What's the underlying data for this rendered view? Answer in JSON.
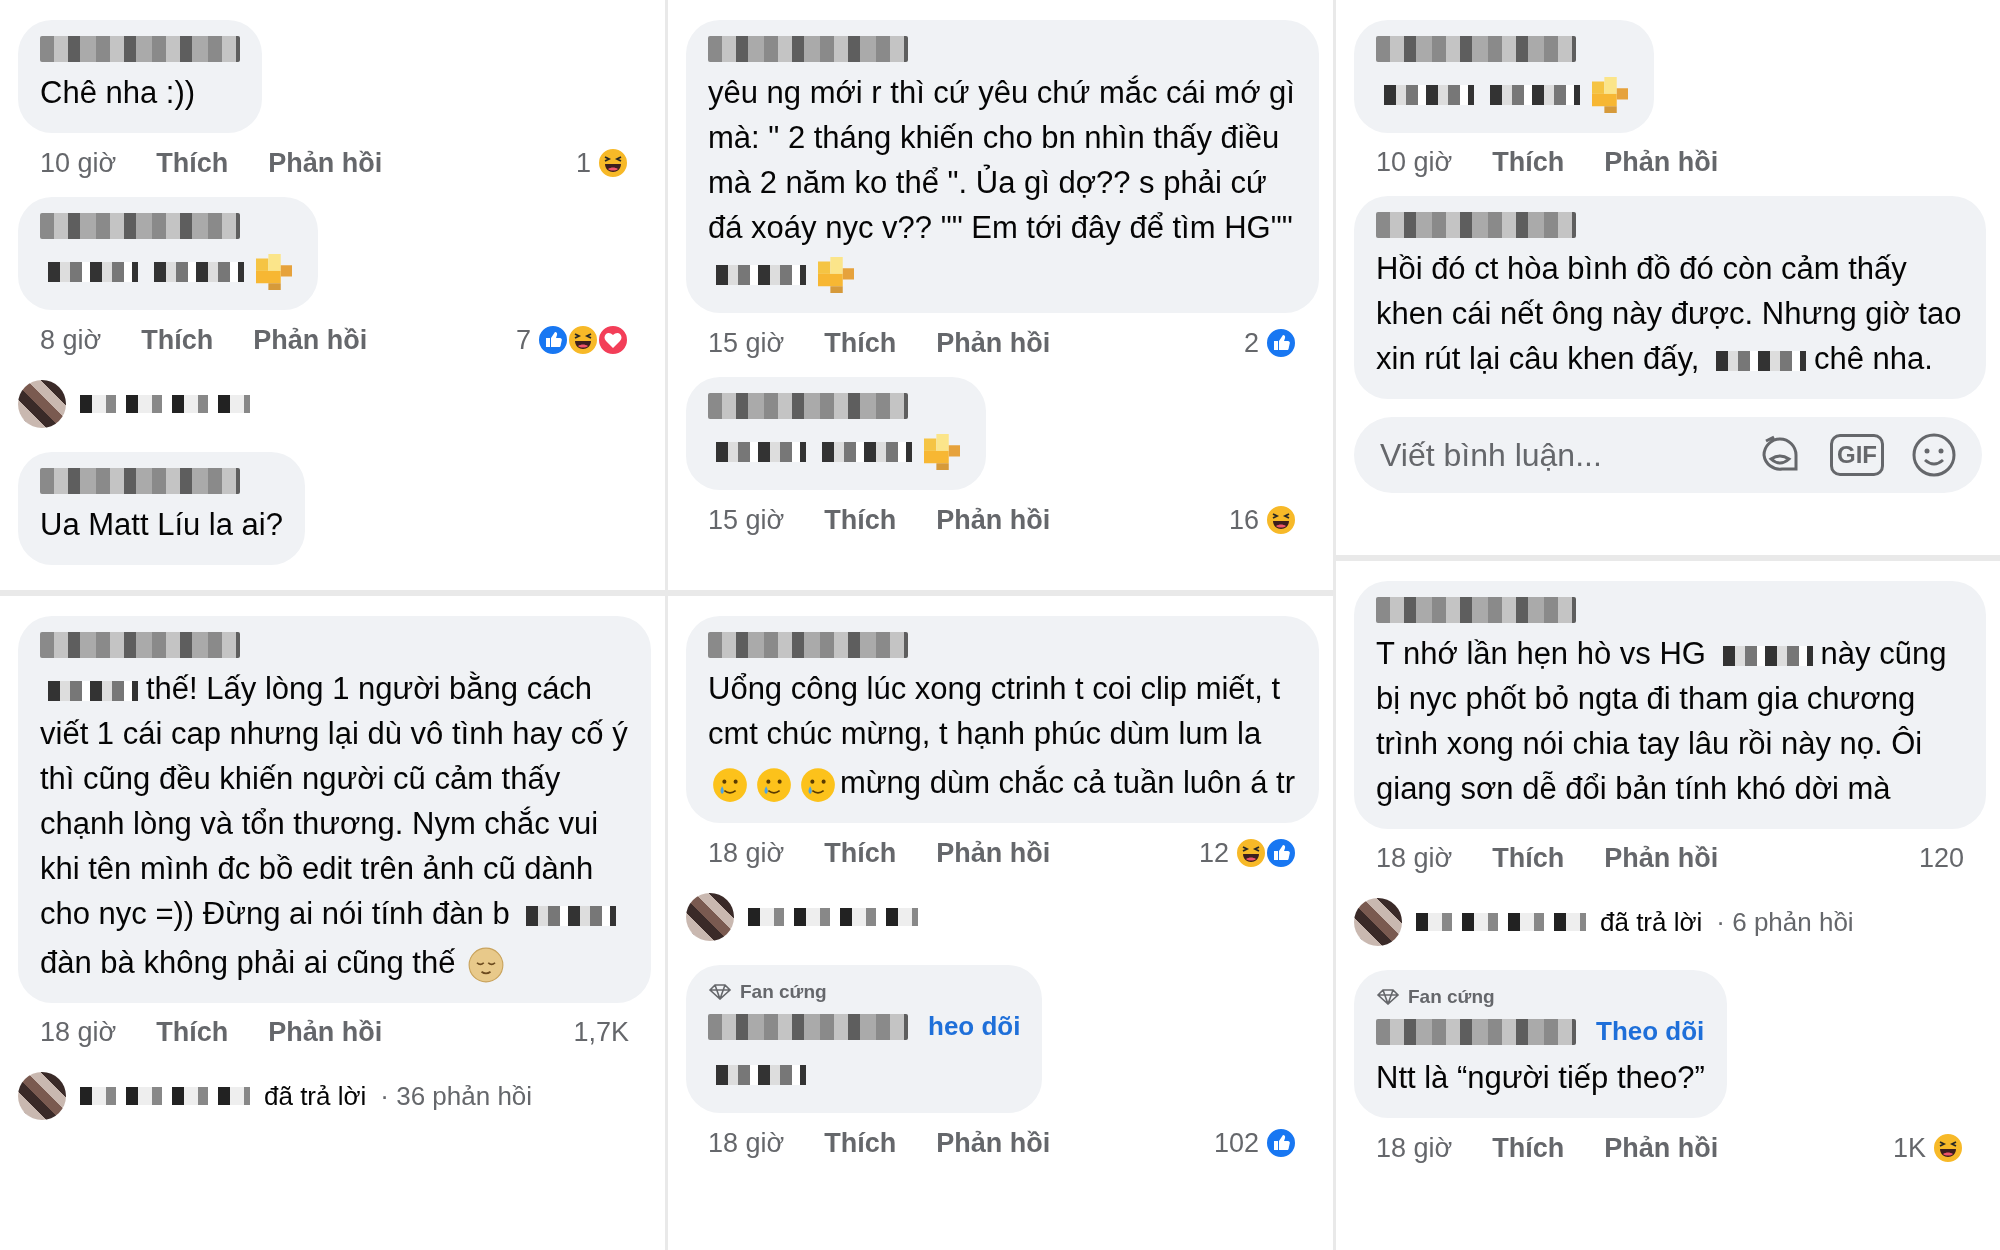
{
  "columns": [
    {
      "panels": [
        {
          "items": [
            {
              "kind": "comment",
              "body": [
                {
                  "kind": "text",
                  "text": "Chê nha :))"
                }
              ],
              "time": "10 giờ",
              "like": "Thích",
              "reply": "Phản hồi",
              "count": "1",
              "reactions": [
                {
                  "kind": "haha"
                }
              ]
            },
            {
              "kind": "comment",
              "body": [
                {
                  "kind": "redacted"
                },
                {
                  "kind": "redacted"
                },
                {
                  "kind": "pixelated_emoji"
                }
              ],
              "time": "8 giờ",
              "like": "Thích",
              "reply": "Phản hồi",
              "count": "7",
              "reactions": [
                {
                  "kind": "like"
                },
                {
                  "kind": "haha"
                },
                {
                  "kind": "love"
                }
              ]
            },
            {
              "kind": "reply_summary"
            },
            {
              "kind": "comment",
              "body": [
                {
                  "kind": "text",
                  "text": "Ua Matt Líu la ai?"
                }
              ]
            }
          ]
        },
        {
          "items": [
            {
              "kind": "comment",
              "body": [
                {
                  "kind": "redacted"
                },
                {
                  "kind": "text",
                  "text": "thế! Lấy lòng 1 người bằng cách viết 1 cái cap nhưng lại dù vô tình hay cố ý thì cũng đều khiến người cũ cảm thấy chạnh lòng và tổn thương. Nym chắc vui khi tên mình đc bồ edit trên ảnh cũ dành cho nyc =)) Đừng ai nói tính đàn b"
                },
                {
                  "kind": "redacted"
                },
                {
                  "kind": "break"
                },
                {
                  "kind": "text",
                  "text": "đàn bà không phải ai cũng thế"
                },
                {
                  "kind": "relieved_emoji"
                }
              ],
              "time": "18 giờ",
              "like": "Thích",
              "reply": "Phản hồi",
              "count": "1,7K"
            },
            {
              "kind": "reply_summary",
              "text": "đã trả lời",
              "count": "· 36 phản hồi"
            }
          ]
        }
      ]
    },
    {
      "panels": [
        {
          "items": [
            {
              "kind": "comment",
              "body": [
                {
                  "kind": "text",
                  "text": "yêu ng mới r thì cứ yêu chứ mắc cái mớ gì mà: \" 2 tháng khiến cho bn nhìn thấy điều mà 2 năm ko thể \". Ủa gì dợ?? s phải cứ đá xoáy nyc v?? \"\" Em tới đây để tìm HG\"\""
                },
                {
                  "kind": "redacted"
                },
                {
                  "kind": "pixelated_emoji"
                }
              ],
              "time": "15 giờ",
              "like": "Thích",
              "reply": "Phản hồi",
              "count": "2",
              "reactions": [
                {
                  "kind": "like"
                }
              ]
            },
            {
              "kind": "comment",
              "body": [
                {
                  "kind": "redacted"
                },
                {
                  "kind": "redacted"
                },
                {
                  "kind": "pixelated_emoji"
                }
              ],
              "time": "15 giờ",
              "like": "Thích",
              "reply": "Phản hồi",
              "count": "16",
              "reactions": [
                {
                  "kind": "haha"
                }
              ]
            }
          ]
        },
        {
          "items": [
            {
              "kind": "comment",
              "body": [
                {
                  "kind": "text",
                  "text": "Uổng công lúc xong ctrinh t coi clip miết, t cmt chúc mừng, t hạnh phúc dùm lum la"
                },
                {
                  "kind": "break"
                },
                {
                  "kind": "tear_smile_emoji"
                },
                {
                  "kind": "tear_smile_emoji"
                },
                {
                  "kind": "tear_smile_emoji"
                },
                {
                  "kind": "text",
                  "text": "mừng dùm chắc cả tuần luôn á tr"
                }
              ],
              "time": "18 giờ",
              "like": "Thích",
              "reply": "Phản hồi",
              "count": "12",
              "reactions": [
                {
                  "kind": "haha"
                },
                {
                  "kind": "like"
                }
              ]
            },
            {
              "kind": "reply_summary"
            },
            {
              "kind": "comment",
              "badge": "Fan cứng",
              "follow": "heo dõi",
              "body": [
                {
                  "kind": "redacted"
                }
              ],
              "time": "18 giờ",
              "like": "Thích",
              "reply": "Phản hồi",
              "count": "102",
              "reactions": [
                {
                  "kind": "like"
                }
              ]
            }
          ]
        }
      ]
    },
    {
      "panels": [
        {
          "items": [
            {
              "kind": "comment",
              "body": [
                {
                  "kind": "redacted"
                },
                {
                  "kind": "redacted"
                },
                {
                  "kind": "pixelated_emoji"
                }
              ],
              "time": "10 giờ",
              "like": "Thích",
              "reply": "Phản hồi"
            },
            {
              "kind": "comment",
              "body": [
                {
                  "kind": "text",
                  "text": "Hồi đó ct hòa bình đồ đó còn cảm thấy khen cái nết ông này được. Nhưng giờ tao xin rút lại câu khen đấy,"
                },
                {
                  "kind": "redacted"
                },
                {
                  "kind": "text",
                  "text": "chê nha."
                }
              ]
            },
            {
              "kind": "comment_input",
              "placeholder": "Viết bình luận...",
              "gif": "GIF"
            }
          ]
        },
        {
          "items": [
            {
              "kind": "comment",
              "body": [
                {
                  "kind": "text",
                  "text": "T nhớ lần hẹn hò vs HG"
                },
                {
                  "kind": "redacted"
                },
                {
                  "kind": "text",
                  "text": "này cũng bị nyc phốt bỏ ngta đi tham gia chương trình xong nói chia tay lâu rồi này nọ. Ôi giang sơn dễ đổi bản tính khó dời mà"
                }
              ],
              "time": "18 giờ",
              "like": "Thích",
              "reply": "Phản hồi",
              "count": "120"
            },
            {
              "kind": "reply_summary",
              "text": "đã trả lời",
              "count": "· 6 phản hồi"
            },
            {
              "kind": "comment",
              "badge": "Fan cứng",
              "follow": "Theo dõi",
              "body": [
                {
                  "kind": "text",
                  "text": "Ntt là “người tiếp theo?”"
                }
              ],
              "time": "18 giờ",
              "like": "Thích",
              "reply": "Phản hồi",
              "count": "1K",
              "reactions": [
                {
                  "kind": "haha"
                }
              ]
            }
          ]
        }
      ]
    }
  ]
}
